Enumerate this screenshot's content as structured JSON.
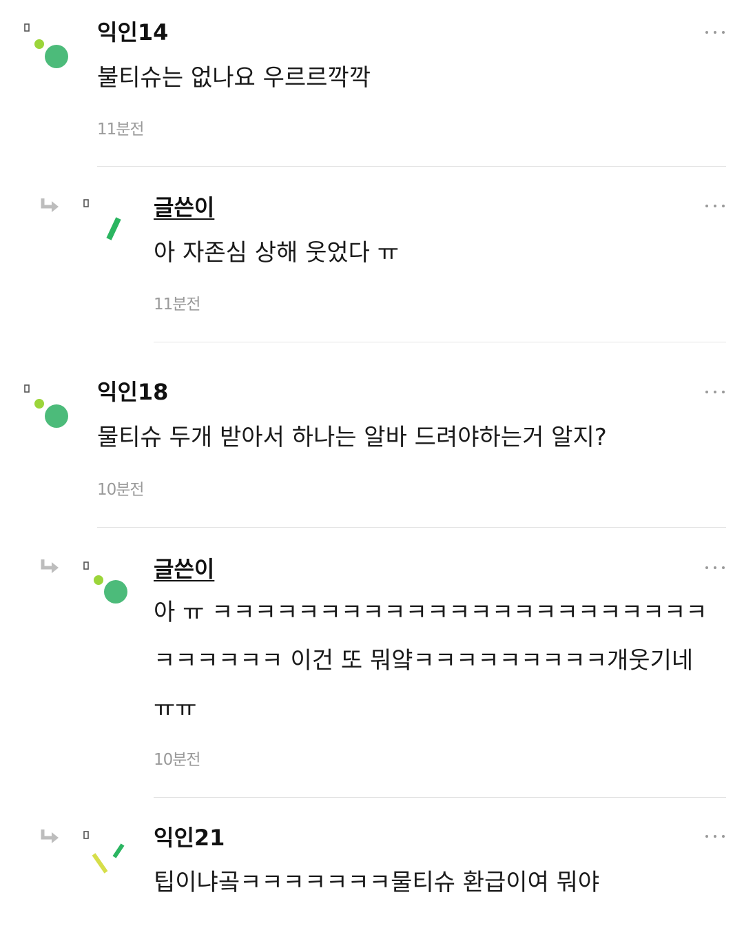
{
  "comments": [
    {
      "author": "익인14",
      "text": "불티슈는 없나요 우르르깍깍",
      "time": "11분전",
      "avatar": "dot-circle-avatar-icon",
      "is_reply": false
    },
    {
      "author": "글쓴이",
      "text": "아 자존심 상해 웃었다 ㅠ",
      "time": "11분전",
      "avatar": "slash-avatar-icon",
      "is_reply": true
    },
    {
      "author": "익인18",
      "text": "물티슈 두개 받아서 하나는 알바 드려야하는거 알지?",
      "time": "10분전",
      "avatar": "dot-circle-avatar-icon",
      "is_reply": false
    },
    {
      "author": "글쓴이",
      "text": "아 ㅠ ㅋㅋㅋㅋㅋㅋㅋㅋㅋㅋㅋㅋㅋㅋㅋㅋㅋㅋㅋㅋㅋㅋㅋㅋㅋㅋㅋㅋㅋ 이건 또 뭐얔ㅋㅋㅋㅋㅋㅋㅋㅋㅋ개웃기네 ㅠㅠ",
      "time": "10분전",
      "avatar": "dot-circle-avatar-icon",
      "is_reply": true
    },
    {
      "author": "익인21",
      "text": "팁이냐곸ㅋㅋㅋㅋㅋㅋㅋ물티슈 환급이여 뭐야",
      "time": "",
      "avatar": "double-slash-avatar-icon",
      "is_reply": true
    }
  ],
  "colors": {
    "avatar_green": "#4cbb7a",
    "avatar_lime": "#9bd53a",
    "avatar_yellow": "#d6de4a",
    "avatar_slash_green": "#2bb561",
    "muted_text": "#9a9a9a",
    "divider": "#e3e3e3",
    "reply_arrow": "#bdbdbd"
  }
}
